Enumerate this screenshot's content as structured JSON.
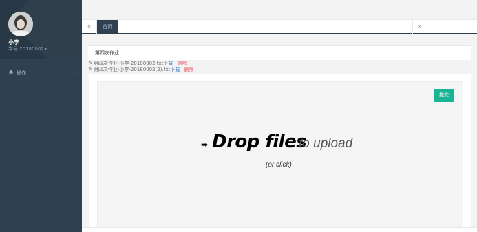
{
  "sidebar": {
    "user_name": "小李",
    "user_id": "学号 20180002",
    "user_id_caret": "▾",
    "nav_items": [
      {
        "label": "操作",
        "icon": "home-icon",
        "chevron": "‹"
      }
    ]
  },
  "tabs": {
    "scroll_left": "«",
    "scroll_right": "»",
    "home_label": "首页"
  },
  "content": {
    "title": "第四次作业",
    "files": [
      {
        "name": "第四次作业-小李-20180002.txt",
        "download": "下载",
        "delete": "删除"
      },
      {
        "name": "第四次作业-小李-20180002(2).txt",
        "download": "下载",
        "delete": "删除"
      }
    ],
    "submit_label": "提交",
    "dropzone": {
      "arrow": "➡",
      "main": "Drop files",
      "sub": "to upload",
      "click": "(or click)"
    }
  },
  "colors": {
    "sidebar_bg": "#2f4050",
    "accent_green": "#1ab394",
    "link_blue": "#337ab7",
    "delete_red": "#ed5565"
  }
}
